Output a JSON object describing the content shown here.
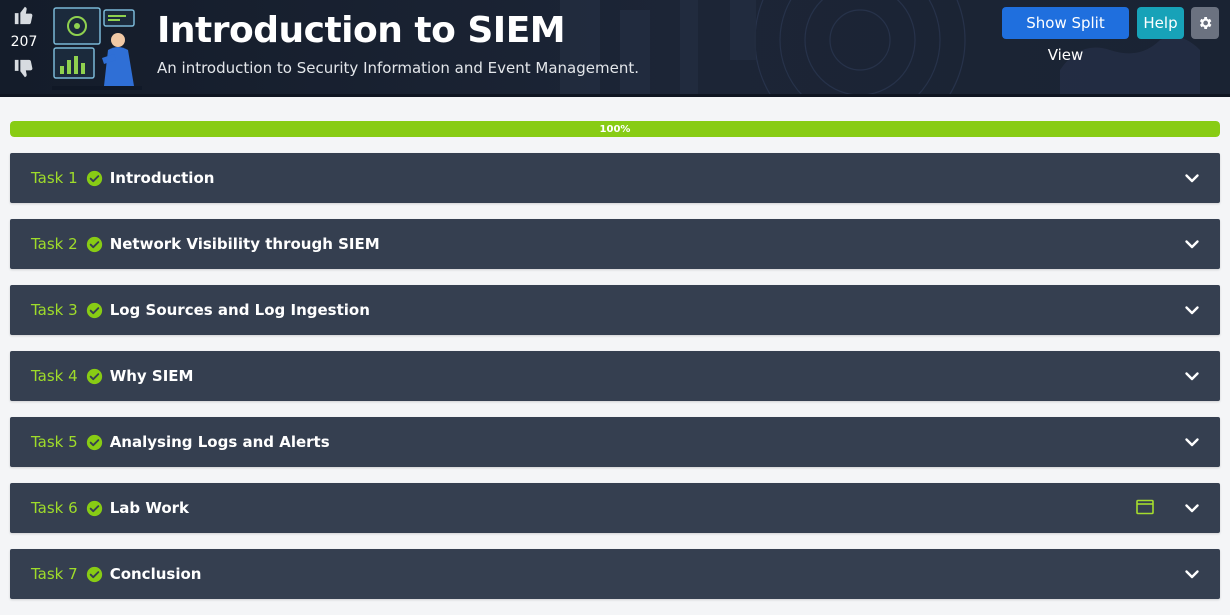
{
  "header": {
    "title": "Introduction to SIEM",
    "subtitle": "An introduction to Security Information and Event Management.",
    "upvote_icon": "thumbs-up-icon",
    "downvote_icon": "thumbs-down-icon",
    "vote_count": "207",
    "buttons": {
      "split_view": "Show Split View",
      "help": "Help",
      "settings_icon": "gear-icon"
    }
  },
  "progress": {
    "label": "100%",
    "value": 100,
    "color": "#88cc14"
  },
  "tasks": [
    {
      "number": "Task 1",
      "title": "Introduction",
      "completed": true
    },
    {
      "number": "Task 2",
      "title": "Network Visibility through SIEM",
      "completed": true
    },
    {
      "number": "Task 3",
      "title": "Log Sources and Log Ingestion",
      "completed": true
    },
    {
      "number": "Task 4",
      "title": "Why SIEM",
      "completed": true
    },
    {
      "number": "Task 5",
      "title": "Analysing Logs and Alerts",
      "completed": true
    },
    {
      "number": "Task 6",
      "title": "Lab Work",
      "completed": true,
      "has_machine_icon": true
    },
    {
      "number": "Task 7",
      "title": "Conclusion",
      "completed": true
    }
  ],
  "colors": {
    "task_bg": "#353f50",
    "task_number": "#9fdc2a",
    "check": "#88cc14",
    "split_button": "#1f6fde",
    "help_button": "#17a2b8",
    "settings_button": "#6b7280"
  }
}
